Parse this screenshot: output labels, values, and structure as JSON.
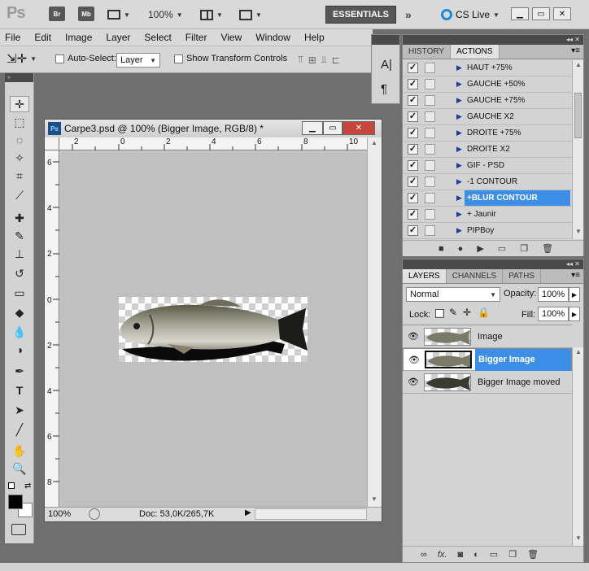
{
  "appbar": {
    "logo": "Ps",
    "bridge": "Br",
    "minibridge": "Mb",
    "zoom": "100%",
    "workspace": "ESSENTIALS",
    "cslive": "CS Live"
  },
  "menu": [
    "File",
    "Edit",
    "Image",
    "Layer",
    "Select",
    "Filter",
    "View",
    "Window",
    "Help"
  ],
  "options": {
    "auto_select_label": "Auto-Select:",
    "auto_select_value": "Layer",
    "transform_label": "Show Transform Controls"
  },
  "document": {
    "title": "Carpe3.psd @ 100% (Bigger Image, RGB/8) *",
    "zoom": "100%",
    "doc_info": "Doc: 53,0K/265,7K",
    "ruler_top": [
      "2",
      "0",
      "2",
      "4",
      "6",
      "8",
      "10"
    ],
    "ruler_left": [
      "6",
      "4",
      "2",
      "0",
      "2",
      "4",
      "6",
      "8"
    ]
  },
  "history_panel": {
    "tabs": [
      "HISTORY",
      "ACTIONS"
    ],
    "active_tab": "ACTIONS",
    "actions": [
      {
        "label": "HAUT +75%",
        "selected": false
      },
      {
        "label": "GAUCHE +50%",
        "selected": false
      },
      {
        "label": "GAUCHE +75%",
        "selected": false
      },
      {
        "label": "GAUCHE X2",
        "selected": false
      },
      {
        "label": "DROITE +75%",
        "selected": false
      },
      {
        "label": "DROITE X2",
        "selected": false
      },
      {
        "label": "GIF - PSD",
        "selected": false
      },
      {
        "label": "-1 CONTOUR",
        "selected": false
      },
      {
        "label": "+BLUR CONTOUR",
        "selected": true
      },
      {
        "label": "+ Jaunir",
        "selected": false
      },
      {
        "label": "PIPBoy",
        "selected": false
      }
    ]
  },
  "layers_panel": {
    "tabs": [
      "LAYERS",
      "CHANNELS",
      "PATHS"
    ],
    "active_tab": "LAYERS",
    "blend_mode": "Normal",
    "opacity_label": "Opacity:",
    "opacity": "100%",
    "lock_label": "Lock:",
    "fill_label": "Fill:",
    "fill": "100%",
    "layers": [
      {
        "name": "Image",
        "selected": false
      },
      {
        "name": "Bigger Image",
        "selected": true
      },
      {
        "name": "Bigger Image moved",
        "selected": false
      }
    ]
  },
  "colors": {
    "selection": "#3c8ee6",
    "foreground": "#000000",
    "background": "#ffffff"
  }
}
